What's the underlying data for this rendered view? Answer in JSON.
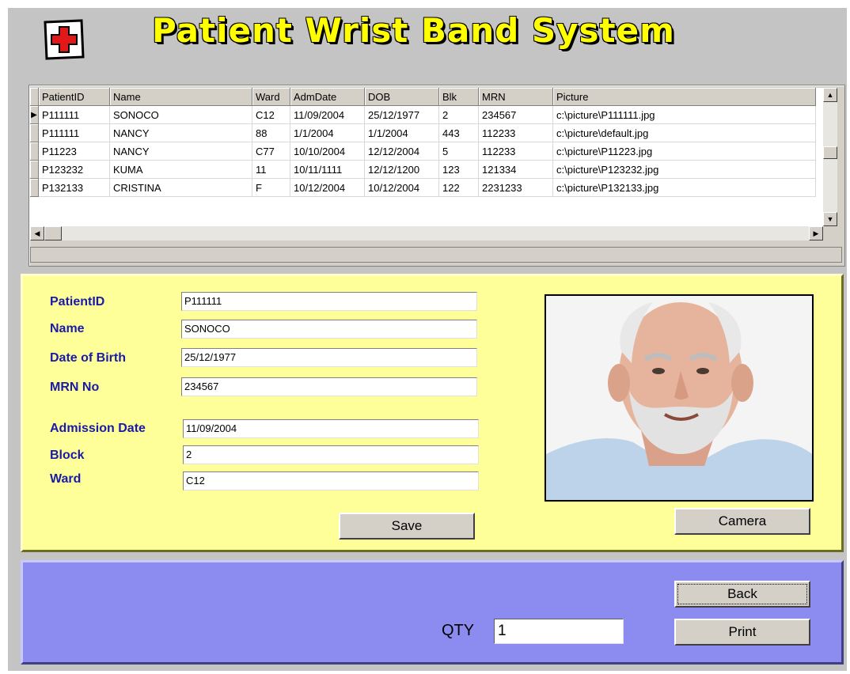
{
  "header": {
    "title": "Patient Wrist Band System"
  },
  "grid": {
    "columns": [
      "PatientID",
      "Name",
      "Ward",
      "AdmDate",
      "DOB",
      "Blk",
      "MRN",
      "Picture"
    ],
    "rows": [
      [
        "P111111",
        "SONOCO",
        "C12",
        "11/09/2004",
        "25/12/1977",
        "2",
        "234567",
        "c:\\picture\\P111111.jpg"
      ],
      [
        "P111111",
        "NANCY",
        "88",
        "1/1/2004",
        "1/1/2004",
        "443",
        "112233",
        "c:\\picture\\default.jpg"
      ],
      [
        "P11223",
        "NANCY",
        "C77",
        "10/10/2004",
        "12/12/2004",
        "5",
        "112233",
        "c:\\picture\\P11223.jpg"
      ],
      [
        "P123232",
        "KUMA",
        "11",
        "10/11/1111",
        "12/12/1200",
        "123",
        "121334",
        "c:\\picture\\P123232.jpg"
      ],
      [
        "P132133",
        "CRISTINA",
        "F",
        "10/12/2004",
        "10/12/2004",
        "122",
        "2231233",
        "c:\\picture\\P132133.jpg"
      ]
    ],
    "selected_row": 0
  },
  "form": {
    "patientid_label": "PatientID",
    "patientid_value": "P111111",
    "name_label": "Name",
    "name_value": "SONOCO",
    "dob_label": "Date of Birth",
    "dob_value": "25/12/1977",
    "mrn_label": "MRN No",
    "mrn_value": "234567",
    "admission_label": "Admission Date",
    "admission_value": "11/09/2004",
    "block_label": "Block",
    "block_value": "2",
    "ward_label": "Ward",
    "ward_value": "C12",
    "save_label": "Save",
    "camera_label": "Camera"
  },
  "footer": {
    "back_label": "Back",
    "print_label": "Print",
    "qty_label": "QTY",
    "qty_value": "1"
  },
  "colors": {
    "form_bg": "#ffff99",
    "footer_bg": "#8c8cf0",
    "label_blue": "#1a1aa8",
    "title_yellow": "#ffff00"
  }
}
